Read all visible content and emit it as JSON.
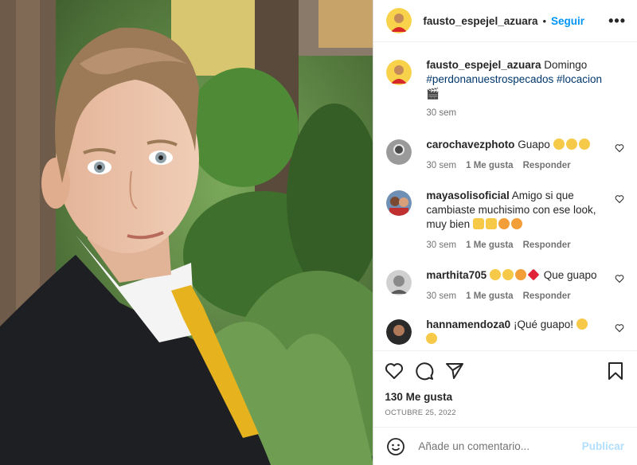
{
  "header": {
    "username": "fausto_espejel_azuara",
    "separator": "•",
    "follow_label": "Seguir",
    "more_label": "•••"
  },
  "caption": {
    "username": "fausto_espejel_azuara",
    "text": "Domingo",
    "hashtags": "#perdonanuestrospecados #locacion",
    "emoji": "🎬",
    "time": "30 sem"
  },
  "comments": [
    {
      "username": "carochavezphoto",
      "text": "Guapo",
      "emoji_count": 3,
      "time": "30 sem",
      "likes": "1 Me gusta",
      "reply": "Responder"
    },
    {
      "username": "mayasolisoficial",
      "text": "Amigo si que cambiaste muchisimo con ese look, muy bien",
      "time": "30 sem",
      "likes": "1 Me gusta",
      "reply": "Responder"
    },
    {
      "username": "marthita705",
      "text": "Que guapo",
      "time": "30 sem",
      "likes": "1 Me gusta",
      "reply": "Responder"
    },
    {
      "username": "hannamendoza0",
      "text": "¡Qué guapo!",
      "time": "",
      "likes": "",
      "reply": ""
    }
  ],
  "actions": {
    "likes": "130 Me gusta",
    "date": "OCTUBRE 25, 2022"
  },
  "add_comment": {
    "placeholder": "Añade un comentario...",
    "post_label": "Publicar"
  },
  "colors": {
    "link": "#0095f6",
    "tag": "#00376b",
    "muted": "#737373",
    "post_disabled": "#b2dffc"
  }
}
